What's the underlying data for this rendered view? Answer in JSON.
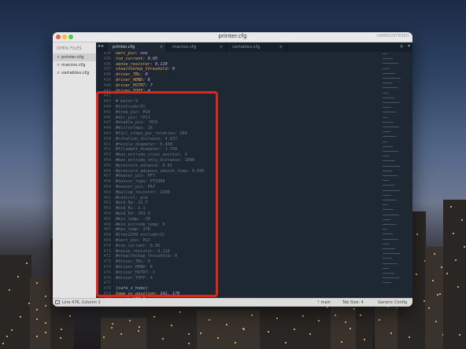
{
  "window": {
    "title": "printer.cfg",
    "unregistered": "UNREGISTERED"
  },
  "sidebar": {
    "header": "OPEN FILES",
    "files": [
      {
        "name": "printer.cfg",
        "active": true
      },
      {
        "name": "macros.cfg",
        "active": false
      },
      {
        "name": "variables.cfg",
        "active": false
      }
    ]
  },
  "tabs": [
    {
      "label": "printer.cfg",
      "active": true
    },
    {
      "label": "macros.cfg",
      "active": false
    },
    {
      "label": "variables.cfg",
      "active": false
    }
  ],
  "editor": {
    "lines": [
      {
        "n": "434",
        "text": "uart_pin: PD8",
        "kind": "kv"
      },
      {
        "n": "435",
        "text": "run_current: 0.85",
        "kind": "kv"
      },
      {
        "n": "436",
        "text": "sense_resistor: 0.110",
        "kind": "kv"
      },
      {
        "n": "437",
        "text": "stealthchop_threshold: 0",
        "kind": "kv"
      },
      {
        "n": "438",
        "text": "driver_TBL: 0",
        "kind": "kv"
      },
      {
        "n": "439",
        "text": "driver_HEND: 6",
        "kind": "kv"
      },
      {
        "n": "440",
        "text": "driver_HSTRT: 7",
        "kind": "kv"
      },
      {
        "n": "441",
        "text": "driver_TOFF: 4",
        "kind": "kv"
      },
      {
        "n": "442",
        "text": "",
        "kind": "blank"
      },
      {
        "n": "443",
        "text": "# motor-9",
        "kind": "comment"
      },
      {
        "n": "444",
        "text": "#[extruder3]",
        "kind": "comment"
      },
      {
        "n": "445",
        "text": "#step_pin: PG4",
        "kind": "comment"
      },
      {
        "n": "446",
        "text": "#dir_pin: !PC1",
        "kind": "comment"
      },
      {
        "n": "447",
        "text": "#enable_pin: !PC0",
        "kind": "comment"
      },
      {
        "n": "448",
        "text": "#microsteps: 16",
        "kind": "comment"
      },
      {
        "n": "449",
        "text": "#full_steps_per_rotation: 200",
        "kind": "comment"
      },
      {
        "n": "450",
        "text": "#rotation_distance: 4.637",
        "kind": "comment"
      },
      {
        "n": "451",
        "text": "#nozzle_diameter: 0.400",
        "kind": "comment"
      },
      {
        "n": "452",
        "text": "#filament_diameter: 1.750",
        "kind": "comment"
      },
      {
        "n": "453",
        "text": "#max_extrude_cross_section: 4",
        "kind": "comment"
      },
      {
        "n": "454",
        "text": "#max_extrude_only_distance: 1000",
        "kind": "comment"
      },
      {
        "n": "455",
        "text": "#pressure_advance: 0.02",
        "kind": "comment"
      },
      {
        "n": "456",
        "text": "#pressure_advance_smooth_time: 0.030",
        "kind": "comment"
      },
      {
        "n": "457",
        "text": "#heater_pin: PF7",
        "kind": "comment"
      },
      {
        "n": "458",
        "text": "#sensor_type: PT1000",
        "kind": "comment"
      },
      {
        "n": "459",
        "text": "#sensor_pin: PA7",
        "kind": "comment"
      },
      {
        "n": "460",
        "text": "#pullup_resistor: 2200",
        "kind": "comment"
      },
      {
        "n": "461",
        "text": "#control: pid",
        "kind": "comment"
      },
      {
        "n": "462",
        "text": "#pid_Kp: 21.3",
        "kind": "comment"
      },
      {
        "n": "463",
        "text": "#pid_Ki: 1.1",
        "kind": "comment"
      },
      {
        "n": "464",
        "text": "#pid_Kd: 103.3",
        "kind": "comment"
      },
      {
        "n": "465",
        "text": "#min_temp: -20",
        "kind": "comment"
      },
      {
        "n": "466",
        "text": "#min_extrude_temp: 0",
        "kind": "comment"
      },
      {
        "n": "467",
        "text": "#max_temp: 370",
        "kind": "comment"
      },
      {
        "n": "468",
        "text": "#[tmc2209 extruder3]",
        "kind": "comment"
      },
      {
        "n": "469",
        "text": "#uart_pin: PG7",
        "kind": "comment"
      },
      {
        "n": "470",
        "text": "#run_current: 0.85",
        "kind": "comment"
      },
      {
        "n": "471",
        "text": "#sense_resistor: 0.110",
        "kind": "comment"
      },
      {
        "n": "472",
        "text": "#stealthchop_threshold: 0",
        "kind": "comment"
      },
      {
        "n": "473",
        "text": "#driver_TBL: 0",
        "kind": "comment"
      },
      {
        "n": "474",
        "text": "#driver_HEND: 6",
        "kind": "comment"
      },
      {
        "n": "475",
        "text": "#driver_HSTRT: 7",
        "kind": "comment"
      },
      {
        "n": "476",
        "text": "#driver_TOFF: 4",
        "kind": "comment"
      },
      {
        "n": "477",
        "text": "",
        "kind": "blank"
      },
      {
        "n": "478",
        "text": "[safe_z_home]",
        "kind": "section"
      },
      {
        "n": "479",
        "text": "home_xy_position: 141, 179",
        "kind": "kv"
      },
      {
        "n": "480",
        "text": "speed: 100.0",
        "kind": "kv"
      },
      {
        "n": "481",
        "text": "z_hop: 5",
        "kind": "kv"
      },
      {
        "n": "482",
        "text": "",
        "kind": "blank"
      }
    ]
  },
  "status": {
    "position": "Line 476, Column 1",
    "branch": "main",
    "tab_size": "Tab Size: 4",
    "syntax": "Generic Config"
  },
  "colors": {
    "annotation": "#d9281e",
    "editor_bg": "#1e2833",
    "key": "#e9a85d",
    "number": "#c5a5e8",
    "comment": "#6b7885"
  }
}
